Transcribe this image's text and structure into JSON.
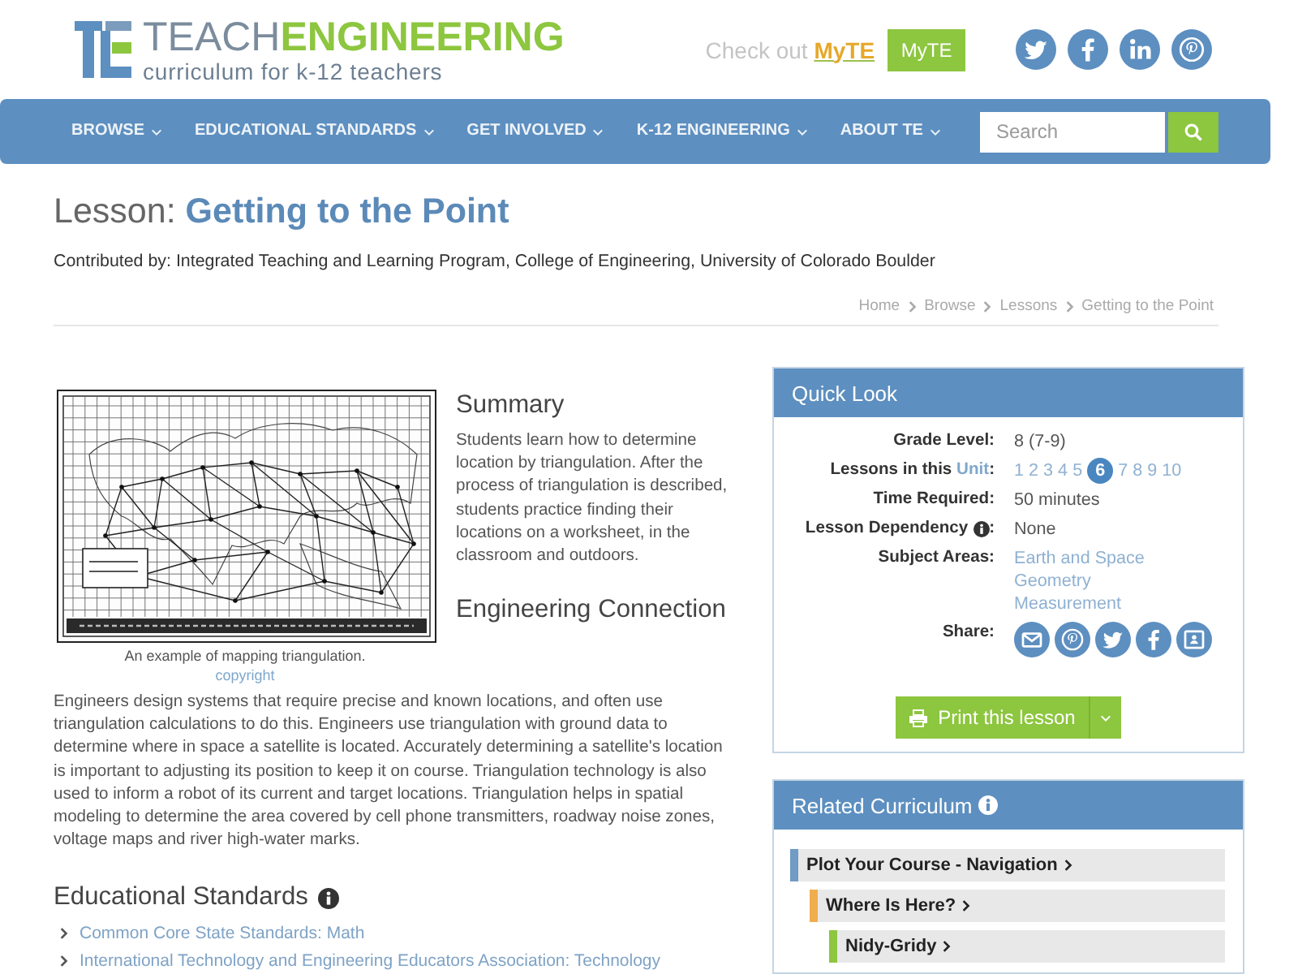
{
  "header": {
    "logo": {
      "wordmark": "TEACH**ENGINEERING**",
      "tagline": "curriculum for k-12 teachers"
    },
    "promo": "Check out **MyTE**",
    "account_button": "MyTE"
  },
  "nav": {
    "items": [
      {
        "label": "BROWSE"
      },
      {
        "label": "EDUCATIONAL STANDARDS"
      },
      {
        "label": "GET INVOLVED"
      },
      {
        "label": "K-12 ENGINEERING"
      },
      {
        "label": "ABOUT TE"
      }
    ],
    "search": {
      "placeholder": "Search"
    }
  },
  "page_title": "Lesson: **Getting to the Point**",
  "contributed_by": "Contributed by: Integrated Teaching and Learning Program, College of Engineering, University of Colorado Boulder",
  "breadcrumb": [
    "Home",
    "Browse",
    "Lessons",
    "Getting to the Point"
  ],
  "figure": {
    "caption": "An example of mapping triangulation.",
    "credit": "copyright"
  },
  "sections": [
    {
      "heading": "Summary",
      "text": "Students learn how to determine location by triangulation. After the process of triangulation is described, students practice finding their locations on a worksheet, in the classroom and outdoors."
    },
    {
      "heading": "Engineering Connection",
      "text": "Engineers design systems that require precise and known locations, and often use triangulation calculations to do this. Engineers use triangulation with ground data to determine where in space a satellite is located. Accurately determining a satellite's location is important to adjusting its position to keep it on course. Triangulation technology is also used to inform a robot of its current and target locations. Triangulation helps in spatial modeling to determine the area covered by cell phone transmitters, roadway noise zones, voltage maps and river high-water marks."
    }
  ],
  "standards": {
    "heading": "Educational Standards",
    "items": [
      "Common Core State Standards: Math",
      "International Technology and Engineering Educators Association: Technology"
    ]
  },
  "quick_look": {
    "title": "Quick Look",
    "rows": [
      {
        "kind": "text",
        "label": "Grade Level:",
        "value": "8 (7-9)"
      },
      {
        "kind": "pages",
        "label": "Lessons in this",
        "link": "Unit",
        "suffix": ":",
        "pages": [
          {
            "label": "1",
            "selected": false
          },
          {
            "label": "2",
            "selected": false
          },
          {
            "label": "3",
            "selected": false
          },
          {
            "label": "4",
            "selected": false
          },
          {
            "label": "5",
            "selected": false
          },
          {
            "label": "6",
            "selected": true
          },
          {
            "label": "7",
            "selected": false
          },
          {
            "label": "8",
            "selected": false
          },
          {
            "label": "9",
            "selected": false
          },
          {
            "label": "10",
            "selected": false
          }
        ]
      },
      {
        "kind": "text",
        "label": "Time Required:",
        "value": "50 minutes"
      },
      {
        "kind": "info",
        "label": "Lesson Dependency",
        "suffix": ":",
        "value": "None"
      },
      {
        "kind": "links",
        "label": "Subject Areas:",
        "links": [
          "Earth and Space",
          "Geometry",
          "Measurement"
        ]
      },
      {
        "kind": "share",
        "label": "Share:"
      }
    ],
    "print_button": "Print this lesson"
  },
  "related": {
    "title": "Related Curriculum",
    "items": [
      {
        "label": "Plot Your Course - Navigation",
        "color": "#6f9bc4",
        "children": [
          {
            "label": "Where Is Here?",
            "color": "#f0ad4e",
            "children": [
              {
                "label": "Nidy-Gridy",
                "color": "#8dc63f"
              }
            ]
          }
        ]
      }
    ]
  }
}
